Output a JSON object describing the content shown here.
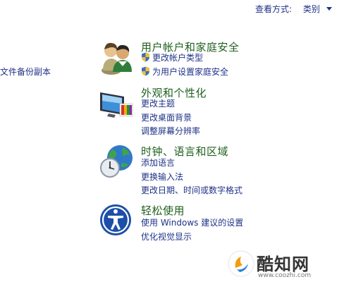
{
  "view": {
    "label": "查看方式:",
    "value": "类别"
  },
  "left_link": "文件备份副本",
  "categories": [
    {
      "title": "用户帐户和家庭安全",
      "icon": "users-icon",
      "links": [
        "更改帐户类型",
        "为用户设置家庭安全"
      ]
    },
    {
      "title": "外观和个性化",
      "icon": "appearance-icon",
      "links": [
        "更改主题",
        "更改桌面背景",
        "调整屏幕分辨率"
      ]
    },
    {
      "title": "时钟、语言和区域",
      "icon": "clock-globe-icon",
      "links": [
        "添加语言",
        "更换输入法",
        "更改日期、时间或数字格式"
      ]
    },
    {
      "title": "轻松使用",
      "icon": "ease-of-access-icon",
      "links": [
        "使用 Windows 建议的设置",
        "优化视觉显示"
      ]
    }
  ],
  "watermark": {
    "brand": "酷知网",
    "url": "www.coozhi.com"
  }
}
